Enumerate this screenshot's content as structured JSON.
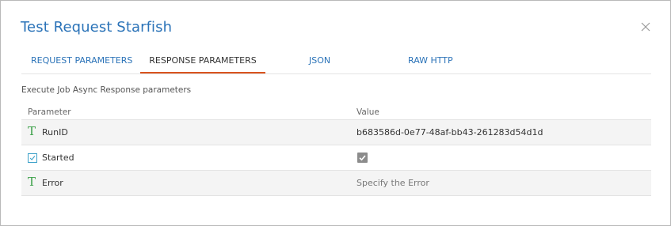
{
  "dialog": {
    "title": "Test Request Starfish"
  },
  "tabs": [
    {
      "label": "REQUEST PARAMETERS",
      "active": false
    },
    {
      "label": "RESPONSE PARAMETERS",
      "active": true
    },
    {
      "label": "JSON",
      "active": false
    },
    {
      "label": "RAW HTTP",
      "active": false
    }
  ],
  "section": {
    "subtitle": "Execute Job Async Response parameters"
  },
  "table": {
    "headers": {
      "parameter": "Parameter",
      "value": "Value"
    },
    "rows": [
      {
        "icon": "text-type-icon",
        "name": "RunID",
        "value": "b683586d-0e77-48af-bb43-261283d54d1d"
      },
      {
        "icon": "boolean-type-icon",
        "name": "Started",
        "value_checked": true
      },
      {
        "icon": "text-type-icon",
        "name": "Error",
        "placeholder": "Specify the Error"
      }
    ]
  },
  "colors": {
    "accent": "#2b73b8",
    "active_tab_underline": "#d9531e",
    "type_icon_green": "#3aa047",
    "checkbox_fill": "#8c8c8c"
  }
}
